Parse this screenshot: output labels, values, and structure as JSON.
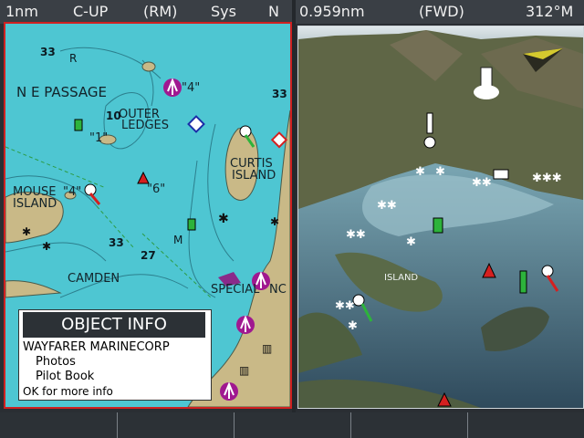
{
  "left_header": {
    "scale": "1nm",
    "orientation": "C-UP",
    "motion_mode": "(RM)",
    "datum": "Sys",
    "north": "N"
  },
  "right_header": {
    "range": "0.959nm",
    "view_mode": "(FWD)",
    "heading": "312°M"
  },
  "chart": {
    "place_labels": [
      "N E PASSAGE",
      "OUTER",
      "LEDGES",
      "CURTIS",
      "ISLAND",
      "MOUSE",
      "ISLAND",
      "CAMDEN",
      "SPECIAL",
      "NC"
    ],
    "depths": [
      "33",
      "33",
      "10",
      "33",
      "27",
      "M",
      "R"
    ],
    "buoy_labels": [
      "\"4\"",
      "\"1\"",
      "\"6\"",
      "\"4\""
    ],
    "colors": {
      "water": "#4ec6d2",
      "land": "#c9b987",
      "selection_border": "#d02020"
    }
  },
  "object_info": {
    "title": "OBJECT INFO",
    "name": "WAYFARER MARINECORP",
    "items": [
      "Photos",
      "Pilot Book"
    ],
    "hint": "OK for more info"
  },
  "view3d": {
    "island_label": "ISLAND"
  },
  "softkeys": [
    "",
    "",
    "",
    "",
    ""
  ]
}
